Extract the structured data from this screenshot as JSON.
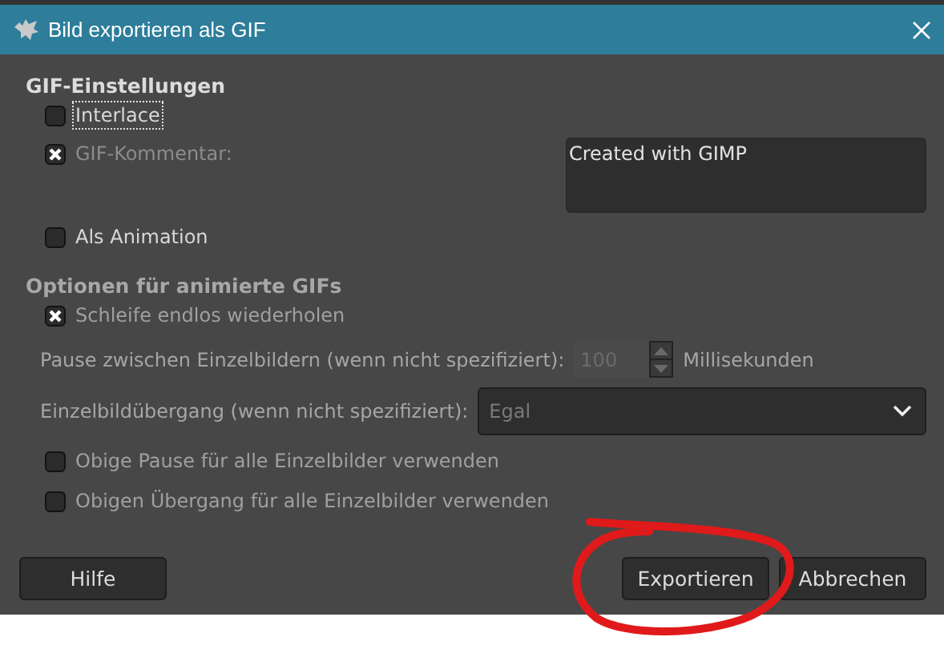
{
  "window": {
    "title": "Bild exportieren als GIF"
  },
  "gif_settings": {
    "heading": "GIF-Einstellungen",
    "interlace": {
      "label": "Interlace",
      "checked": false,
      "focused": true,
      "disabled": false
    },
    "comment": {
      "label": "GIF-Kommentar:",
      "checked": true,
      "disabled": true,
      "value": "Created with GIMP"
    },
    "as_animation": {
      "label": "Als Animation",
      "checked": false,
      "disabled": false
    }
  },
  "animation_options": {
    "heading": "Optionen für animierte GIFs",
    "loop": {
      "label": "Schleife endlos wiederholen",
      "checked": true,
      "disabled": true
    },
    "delay": {
      "label": "Pause zwischen Einzelbildern (wenn nicht spezifiziert):",
      "value": "100",
      "unit": "Millisekunden",
      "disabled": true
    },
    "disposal": {
      "label": "Einzelbildübergang (wenn nicht spezifiziert):",
      "value": "Egal",
      "disabled": true
    },
    "use_delay_for_all": {
      "label": "Obige Pause für alle Einzelbilder verwenden",
      "checked": false,
      "disabled": true
    },
    "use_disposal_for_all": {
      "label": "Obigen Übergang für alle Einzelbilder verwenden",
      "checked": false,
      "disabled": true
    }
  },
  "buttons": [
    {
      "label": "Hilfe"
    },
    {
      "label": "Exportieren"
    },
    {
      "label": "Abbrechen"
    }
  ]
}
